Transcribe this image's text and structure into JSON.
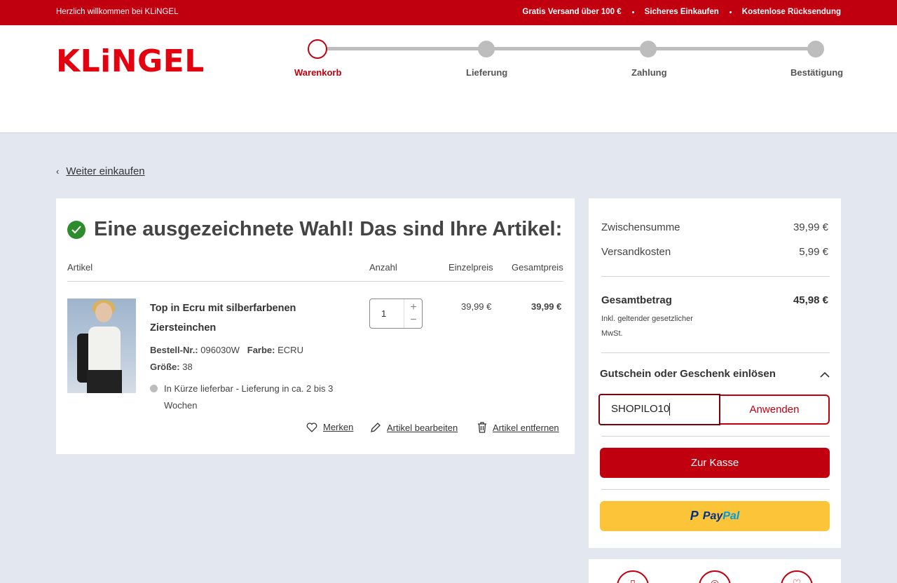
{
  "topbar": {
    "welcome": "Herzlich willkommen bei KLiNGEL",
    "usps": [
      "Gratis Versand über 100 €",
      "Sicheres Einkaufen",
      "Kostenlose Rücksendung"
    ]
  },
  "header": {
    "logo": "KLiNGEL",
    "steps": [
      {
        "label": "Warenkorb",
        "active": true
      },
      {
        "label": "Lieferung",
        "active": false
      },
      {
        "label": "Zahlung",
        "active": false
      },
      {
        "label": "Bestätigung",
        "active": false
      }
    ]
  },
  "nav": {
    "back_label": "Weiter einkaufen"
  },
  "cart": {
    "title": "Eine ausgezeichnete Wahl! Das sind Ihre Artikel:",
    "columns": {
      "article": "Artikel",
      "quantity": "Anzahl",
      "unit_price": "Einzelpreis",
      "total_price": "Gesamtpreis"
    },
    "item": {
      "name": "Top in Ecru mit silberfarbenen Ziersteinchen",
      "order_no_label": "Bestell-Nr.:",
      "order_no": "096030W",
      "color_label": "Farbe:",
      "color": "ECRU",
      "size_label": "Größe:",
      "size": "38",
      "availability": "In Kürze lieferbar - Lieferung in ca. 2 bis 3 Wochen",
      "quantity": "1",
      "unit_price": "39,99 €",
      "total_price": "39,99 €"
    },
    "actions": {
      "save": "Merken",
      "edit": "Artikel bearbeiten",
      "remove": "Artikel entfernen"
    }
  },
  "summary": {
    "subtotal_label": "Zwischensumme",
    "subtotal": "39,99 €",
    "shipping_label": "Versandkosten",
    "shipping": "5,99 €",
    "total_label": "Gesamtbetrag",
    "total": "45,98 €",
    "vat_note": "Inkl. geltender gesetzlicher MwSt.",
    "voucher_heading": "Gutschein oder Geschenk einlösen",
    "voucher_value": "SHOPILO10",
    "apply_label": "Anwenden",
    "checkout_label": "Zur Kasse",
    "paypal_part1": "Pay",
    "paypal_part2": "Pal"
  },
  "colors": {
    "brand_red": "#c1000f",
    "logo_red": "#e3000f",
    "paypal_yellow": "#fcc439",
    "success_green": "#2e8b2e"
  }
}
